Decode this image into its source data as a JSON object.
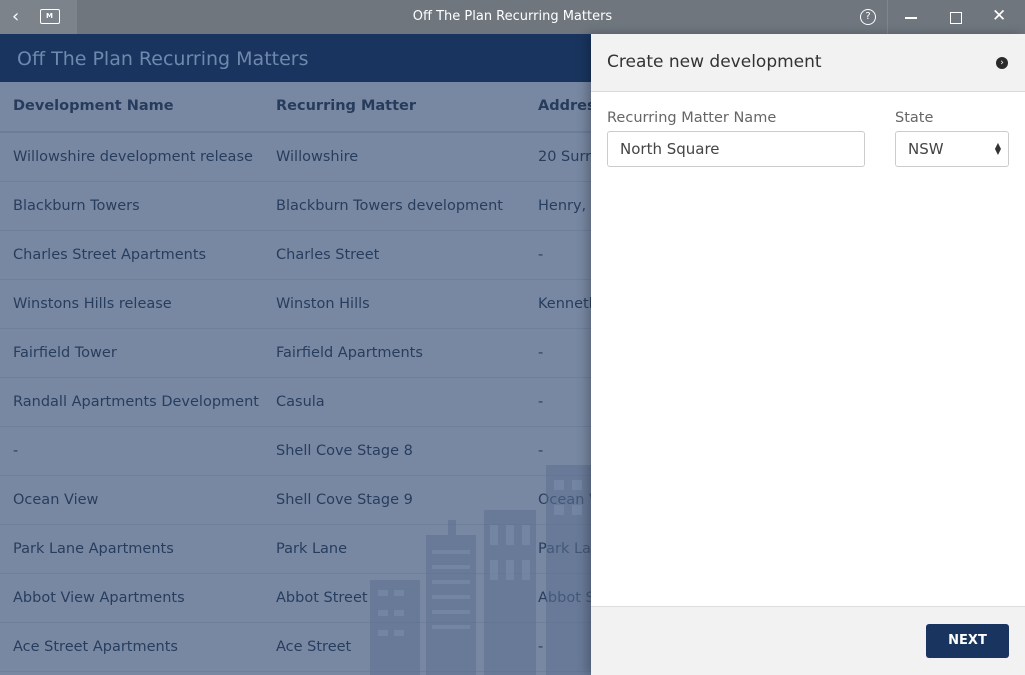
{
  "window": {
    "title": "Off The Plan Recurring Matters",
    "folder_badge": "M",
    "help_glyph": "?",
    "close_glyph": "✕",
    "back_glyph": "‹"
  },
  "app": {
    "title": "Off The Plan Recurring Matters"
  },
  "table": {
    "headers": [
      "Development Name",
      "Recurring Matter",
      "Address"
    ],
    "rows": [
      [
        "Willowshire development release",
        "Willowshire",
        "20 Surr"
      ],
      [
        "Blackburn Towers",
        "Blackburn Towers development",
        "Henry, "
      ],
      [
        "Charles Street Apartments",
        "Charles Street",
        "-"
      ],
      [
        "Winstons Hills release",
        "Winston Hills",
        "Kenneth"
      ],
      [
        "Fairfield Tower",
        "Fairfield Apartments",
        "-"
      ],
      [
        "Randall Apartments Development",
        "Casula",
        "-"
      ],
      [
        "-",
        "Shell Cove Stage 8",
        "-"
      ],
      [
        "Ocean View",
        "Shell Cove Stage 9",
        "Ocean V"
      ],
      [
        "Park Lane Apartments",
        "Park Lane",
        "Park La"
      ],
      [
        "Abbot View Apartments",
        "Abbot Street",
        "Abbot S"
      ],
      [
        "Ace Street Apartments",
        "Ace Street",
        "-"
      ]
    ]
  },
  "panel": {
    "title": "Create new development",
    "collapse_glyph": "›",
    "name_label": "Recurring Matter Name",
    "name_value": "North Square",
    "state_label": "State",
    "state_value": "NSW",
    "next_label": "NEXT"
  }
}
